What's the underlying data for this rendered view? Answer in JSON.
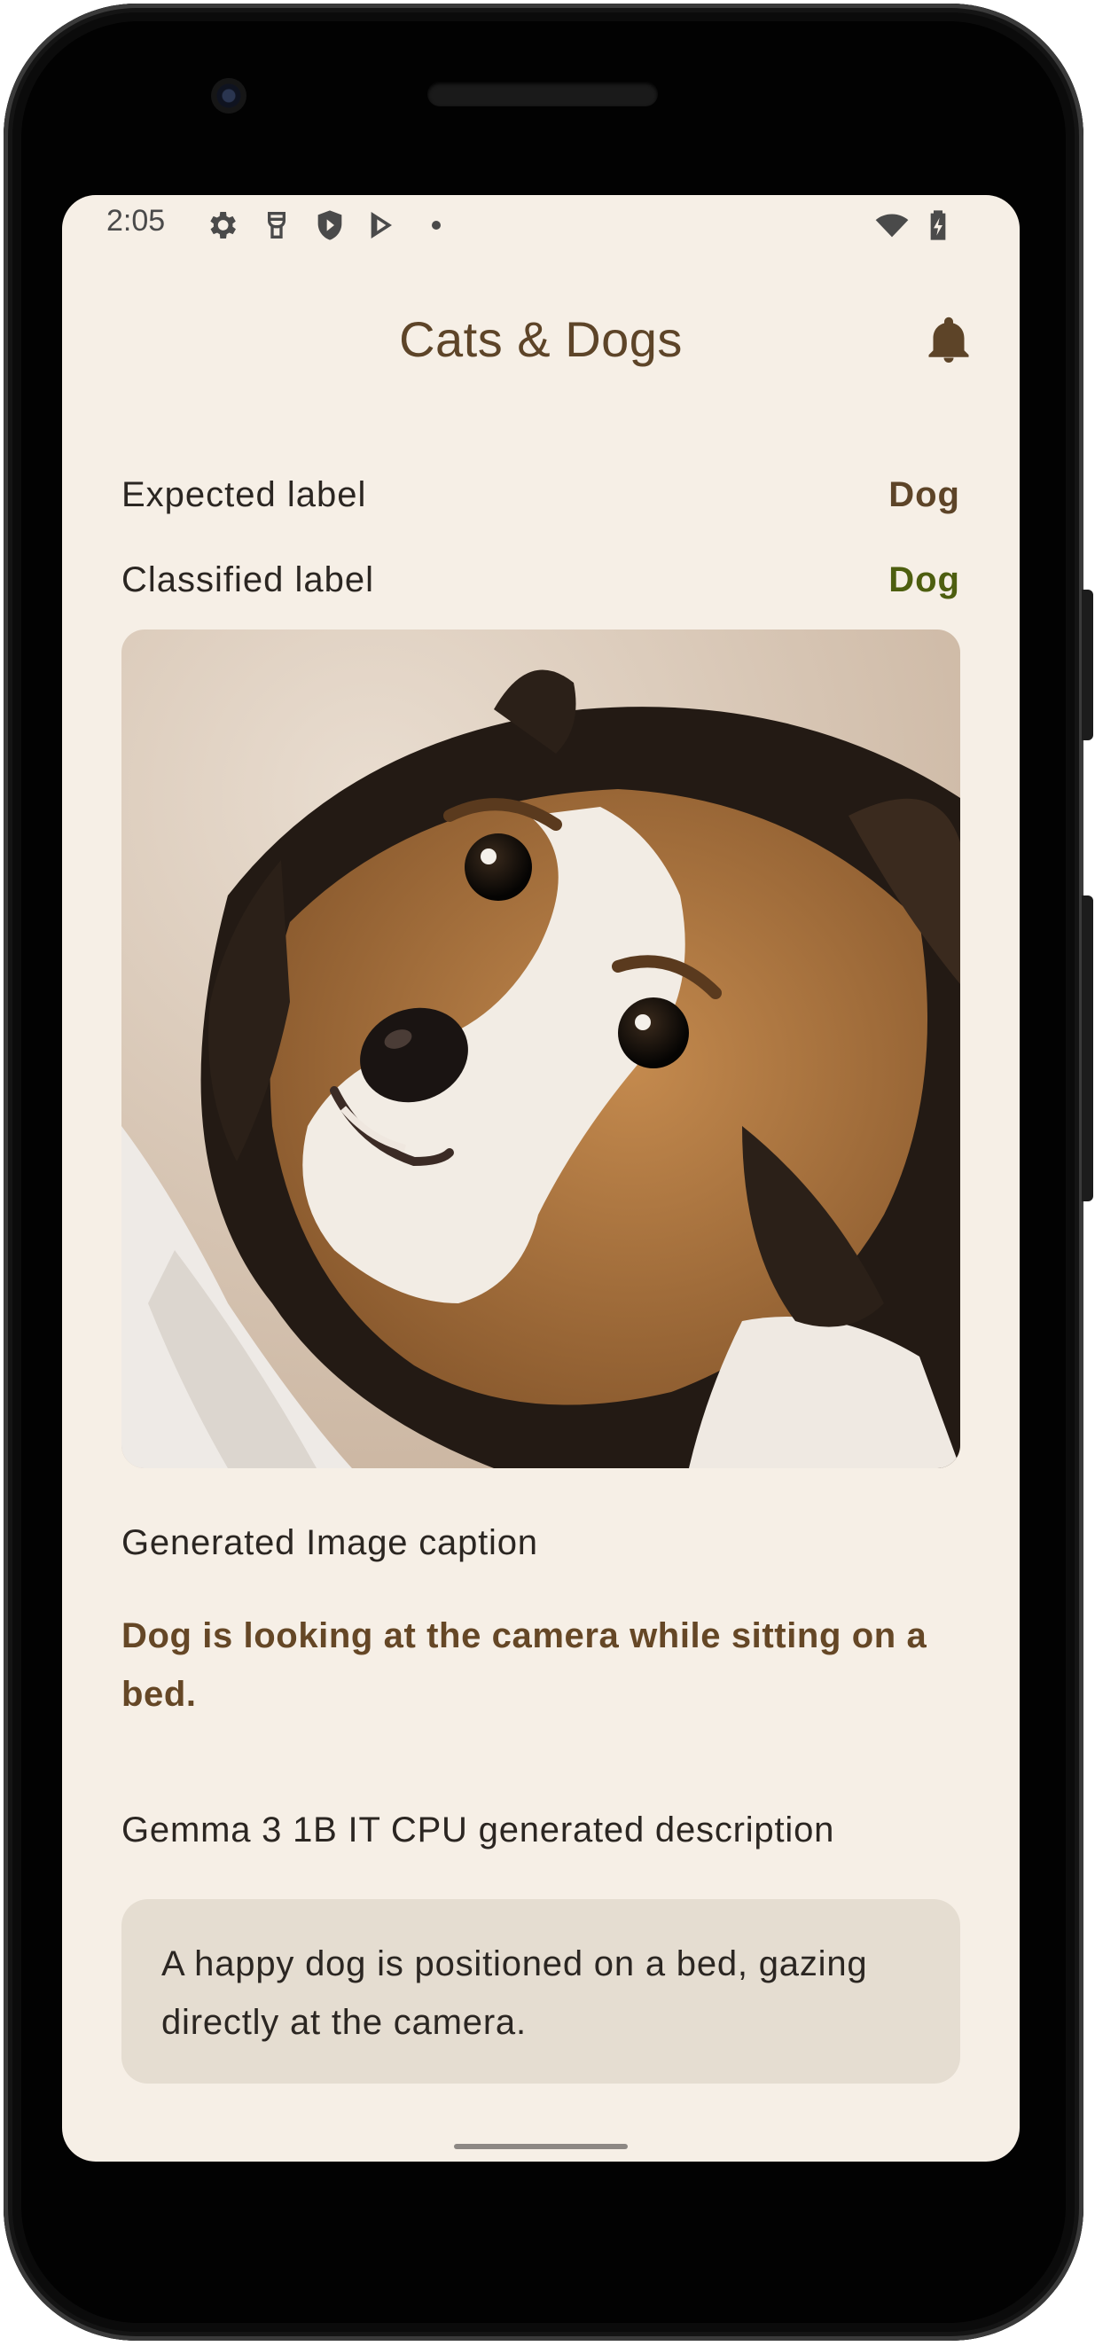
{
  "status_bar": {
    "time": "2:05",
    "icons_left": [
      "settings-icon",
      "sim-icon",
      "shield-icon",
      "play-store-icon",
      "dot-icon"
    ],
    "icons_right": [
      "wifi-icon",
      "battery-charging-icon"
    ]
  },
  "app_bar": {
    "title": "Cats & Dogs",
    "action_icon": "bell-icon"
  },
  "labels": {
    "expected_label": "Expected label",
    "expected_value": "Dog",
    "classified_label": "Classified label",
    "classified_value": "Dog"
  },
  "colors": {
    "background": "#f6efe6",
    "title": "#5d4428",
    "expected_value": "#5d4428",
    "classified_value": "#4d5e0f",
    "caption": "#654726",
    "card": "#e5ddd1"
  },
  "image": {
    "subject": "dog-photo"
  },
  "caption_section": {
    "heading": "Generated Image caption",
    "text": "Dog is looking at the camera while sitting on a bed."
  },
  "description_section": {
    "heading": "Gemma 3 1B IT CPU generated description",
    "text": "A happy dog is positioned on a bed, gazing directly at the camera."
  }
}
